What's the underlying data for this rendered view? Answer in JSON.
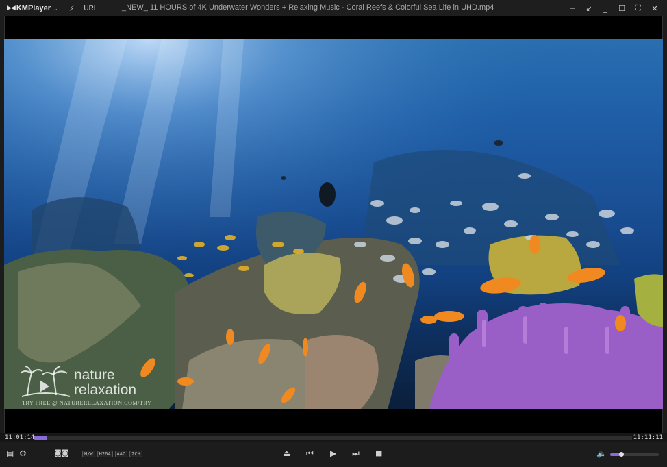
{
  "app": {
    "name": "KMPlayer",
    "url_label": "URL",
    "window_title": "_NEW_ 11 HOURS of 4K Underwater Wonders + Relaxing Music - Coral Reefs & Colorful Sea Life in UHD.mp4"
  },
  "titlebar_icons": [
    "lightning-icon",
    "pin-icon",
    "compact-mode-icon",
    "minimize-icon",
    "maximize-icon",
    "fullscreen-icon",
    "close-icon"
  ],
  "video": {
    "watermark_name": "nature\nrelaxation",
    "watermark_line1": "nature",
    "watermark_line2": "relaxation",
    "watermark_sub": "TRY FREE @ NATURERELAXATION.COM/TRY"
  },
  "playback": {
    "current_time": "11:01:14",
    "total_time": "11:11:11",
    "progress": 0.022
  },
  "codec_badges": [
    "H/W",
    "H264",
    "AAC",
    "2CH"
  ],
  "volume": {
    "level": 0.22
  },
  "colors": {
    "accent": "#8a6bd8",
    "background": "#1c1c1c"
  }
}
